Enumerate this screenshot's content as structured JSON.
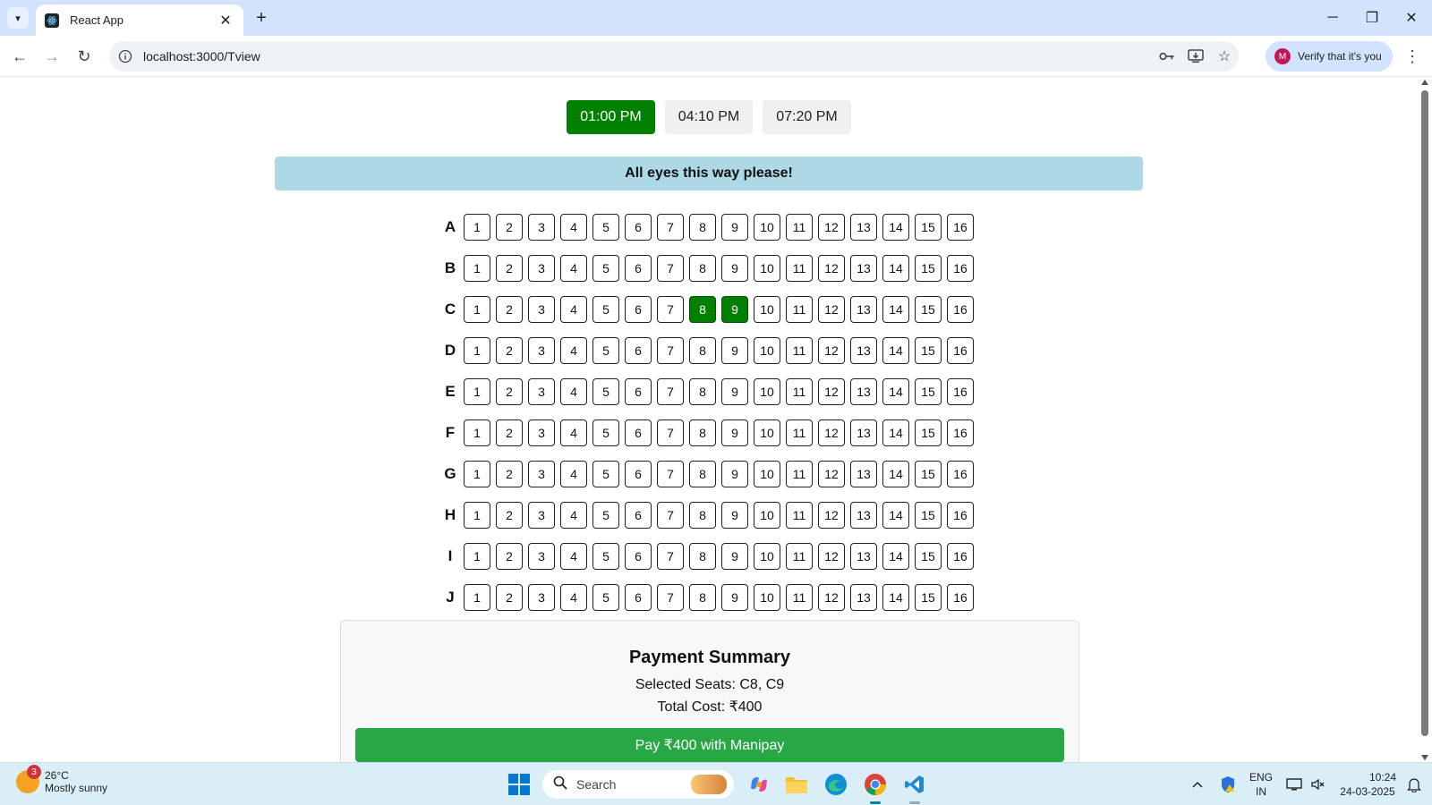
{
  "browser": {
    "tab_title": "React App",
    "url": "localhost:3000/Tview",
    "profile_initial": "M",
    "profile_text": "Verify that it's you"
  },
  "page": {
    "showtimes": [
      {
        "label": "01:00 PM",
        "active": true
      },
      {
        "label": "04:10 PM",
        "active": false
      },
      {
        "label": "07:20 PM",
        "active": false
      }
    ],
    "screen_banner": "All eyes this way please!",
    "rows": [
      "A",
      "B",
      "C",
      "D",
      "E",
      "F",
      "G",
      "H",
      "I",
      "J"
    ],
    "seats_per_row": 16,
    "selected_seats": [
      "C8",
      "C9"
    ],
    "summary": {
      "title": "Payment Summary",
      "selected_label": "Selected Seats: C8, C9",
      "total_label": "Total Cost: ₹400",
      "pay_button": "Pay ₹400 with Manipay"
    }
  },
  "taskbar": {
    "weather_badge": "3",
    "temperature": "26°C",
    "condition": "Mostly sunny",
    "search_placeholder": "Search",
    "lang_line1": "ENG",
    "lang_line2": "IN",
    "time": "10:24",
    "date": "24-03-2025"
  },
  "colors": {
    "selected_green": "#008000",
    "pay_green": "#28a745",
    "banner_blue": "#add8e6"
  }
}
